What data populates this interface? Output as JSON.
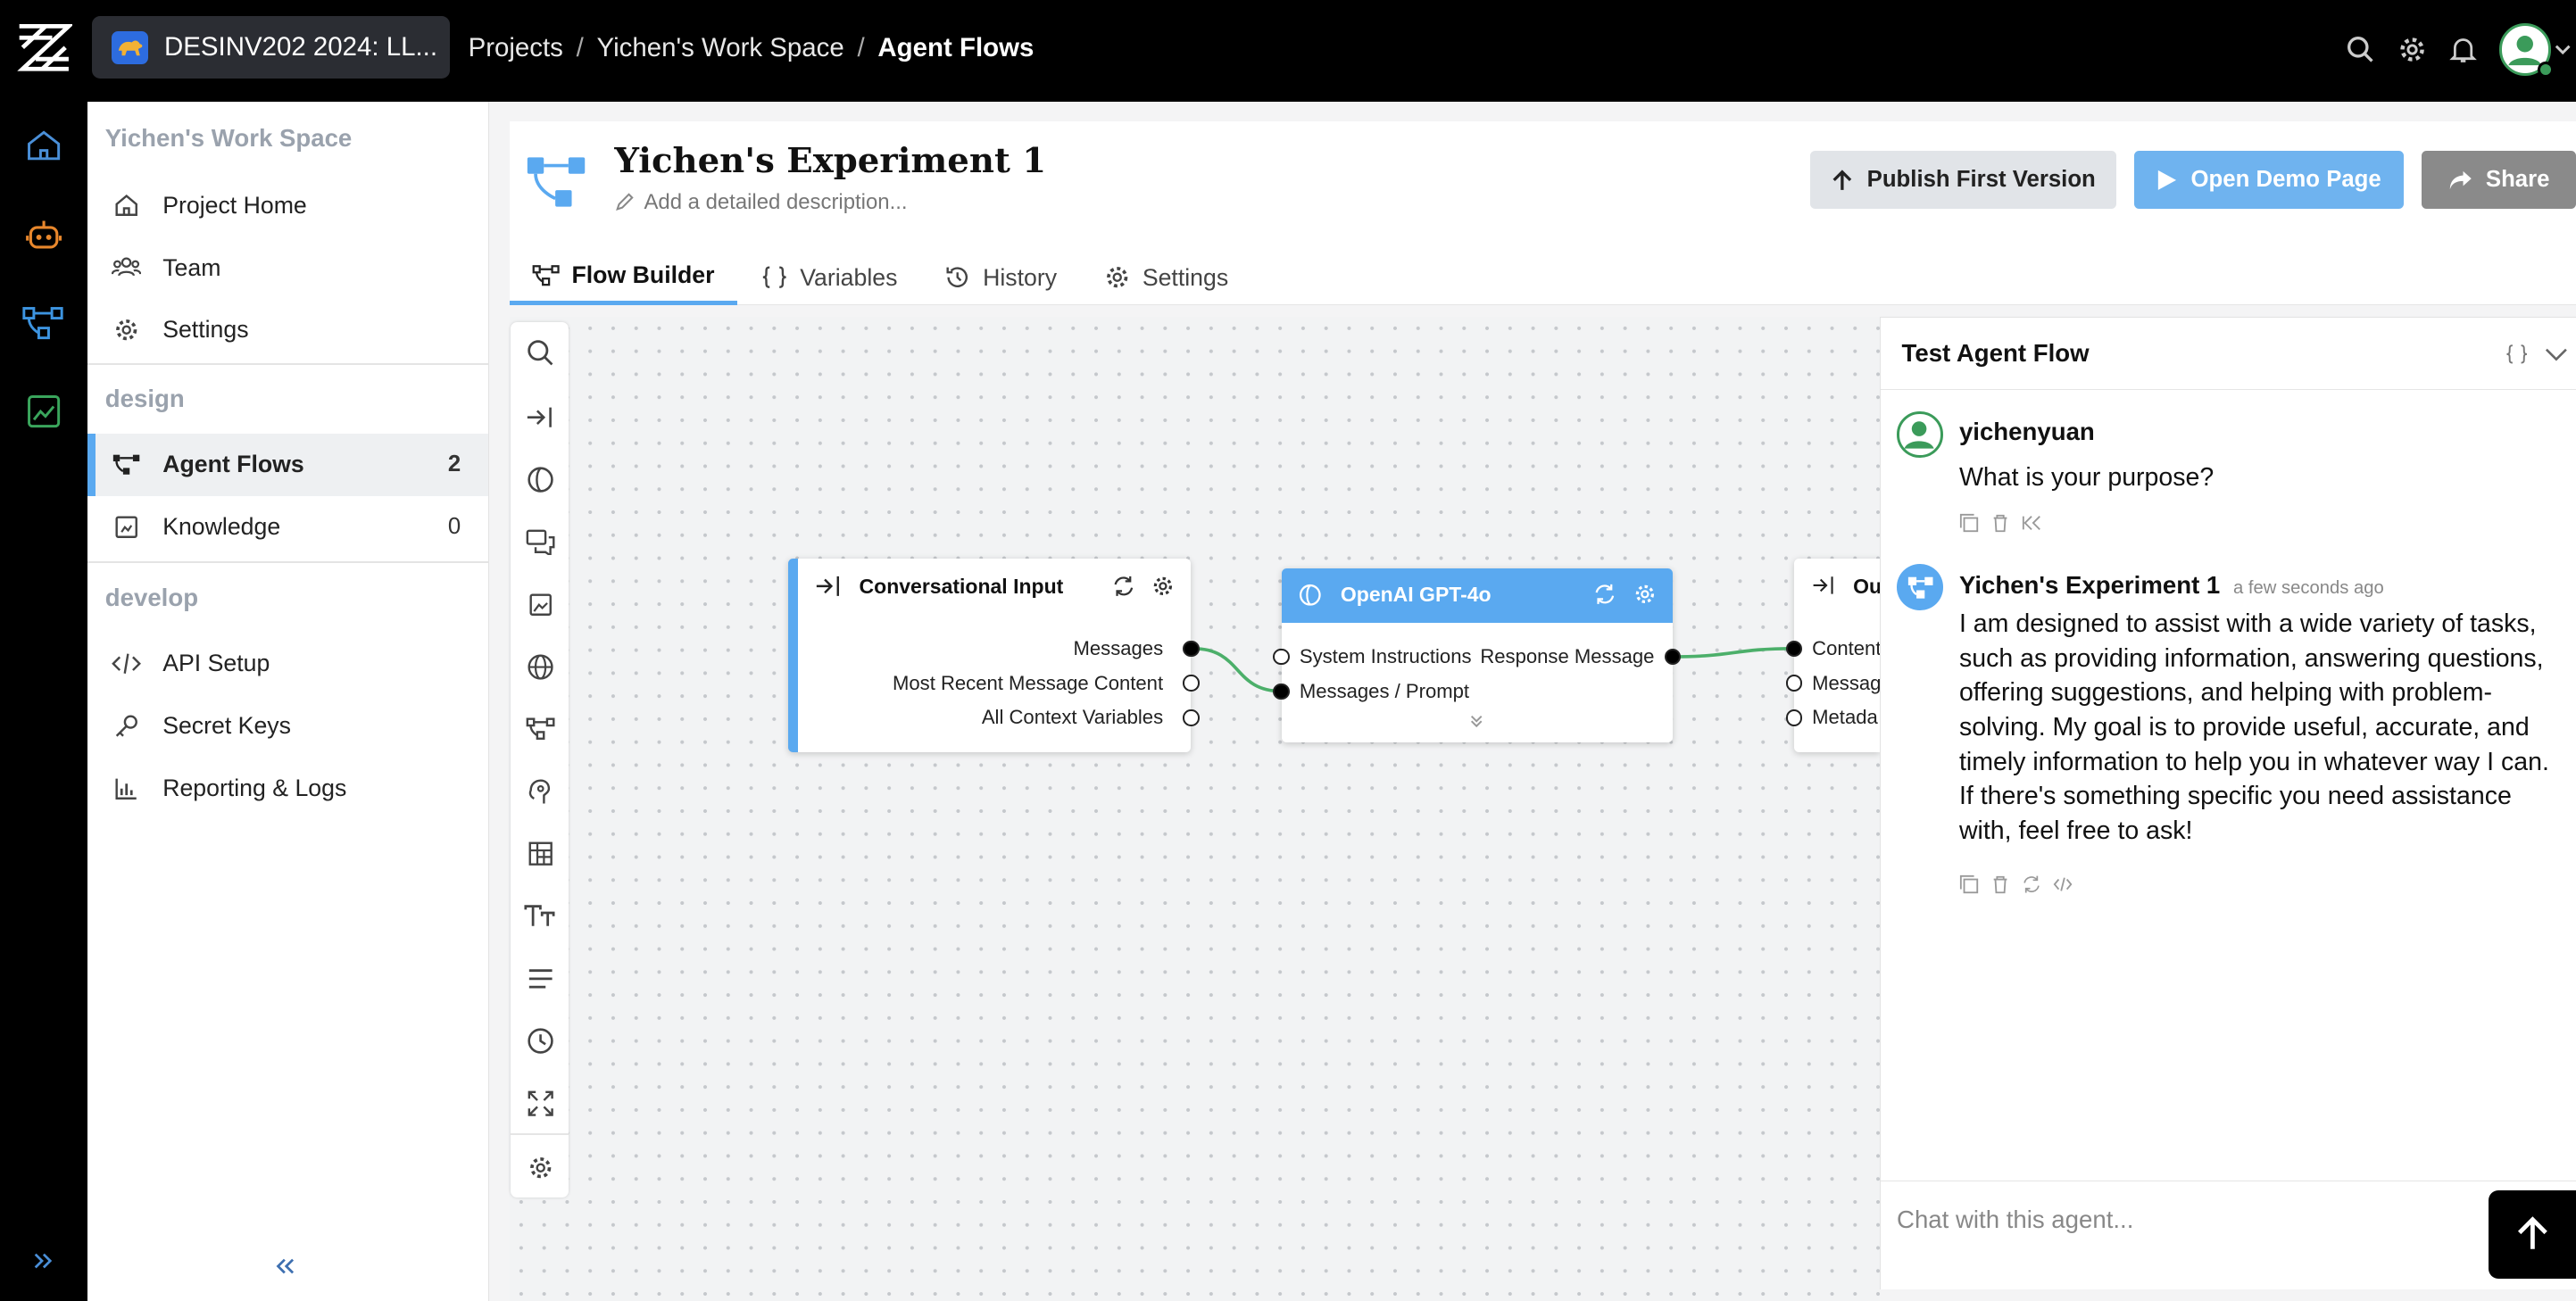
{
  "topbar": {
    "project": "DESINV202 2024: LL...",
    "breadcrumbs": [
      "Projects",
      "Yichen's Work Space",
      "Agent Flows"
    ],
    "separator": "/"
  },
  "sidebar": {
    "workspace": "Yichen's Work Space",
    "top_items": [
      {
        "label": "Project Home",
        "icon": "home-icon"
      },
      {
        "label": "Team",
        "icon": "team-icon"
      },
      {
        "label": "Settings",
        "icon": "gear-icon"
      }
    ],
    "design_section": "design",
    "design_items": [
      {
        "label": "Agent Flows",
        "count": "2",
        "icon": "flow-icon",
        "active": true
      },
      {
        "label": "Knowledge",
        "count": "0",
        "icon": "knowledge-icon"
      }
    ],
    "develop_section": "develop",
    "develop_items": [
      {
        "label": "API Setup",
        "icon": "code-icon"
      },
      {
        "label": "Secret Keys",
        "icon": "key-icon"
      },
      {
        "label": "Reporting & Logs",
        "icon": "chart-icon"
      }
    ]
  },
  "flow": {
    "title": "Yichen's Experiment 1",
    "description_placeholder": "Add a detailed description...",
    "buttons": {
      "publish": "Publish First Version",
      "demo": "Open Demo Page",
      "share": "Share"
    },
    "tabs": [
      "Flow Builder",
      "Variables",
      "History",
      "Settings"
    ],
    "active_tab": "Flow Builder"
  },
  "nodes": {
    "input": {
      "title": "Conversational Input",
      "outputs": [
        "Messages",
        "Most Recent Message Content",
        "All Context Variables"
      ]
    },
    "llm": {
      "title": "OpenAI GPT-4o",
      "inputs": [
        "System Instructions",
        "Messages / Prompt"
      ],
      "output": "Response Message"
    },
    "output": {
      "title_partial": "Ou",
      "inputs": [
        "Content",
        "Messag",
        "Metada"
      ]
    }
  },
  "test_panel": {
    "title": "Test Agent Flow",
    "messages": [
      {
        "author": "yichenyuan",
        "text": "What is your purpose?"
      },
      {
        "author": "Yichen's Experiment 1",
        "time": "a few seconds ago",
        "text": "I am designed to assist with a wide variety of tasks, such as providing information, answering questions, offering suggestions, and helping with problem-solving. My goal is to provide useful, accurate, and timely information to help you in whatever way I can. If there's something specific you need assistance with, feel free to ask!"
      }
    ],
    "input_placeholder": "Chat with this agent..."
  },
  "colors": {
    "accent": "#5aa9f0",
    "llm_header": "#5aa9f0",
    "edge": "#4caf6a",
    "topbar": "#000000"
  }
}
